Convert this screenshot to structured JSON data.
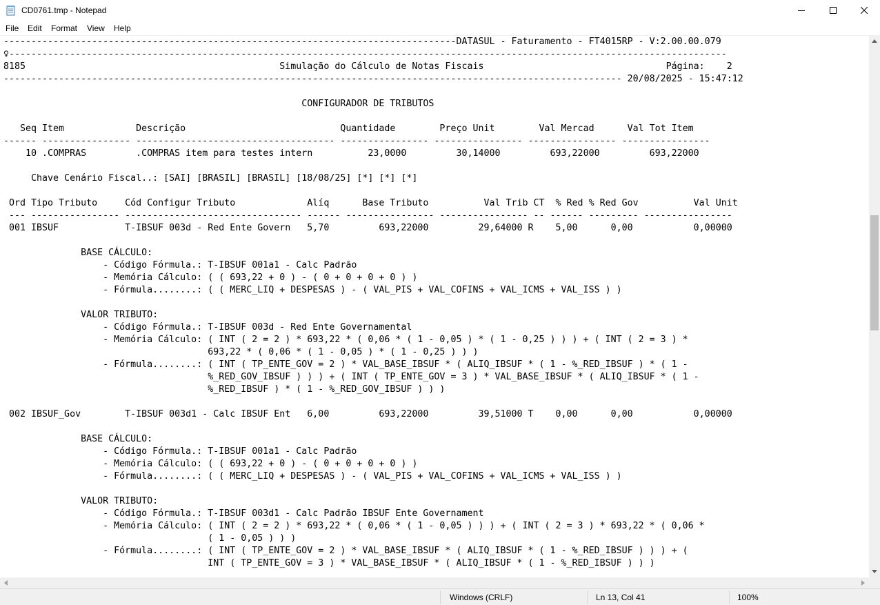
{
  "window": {
    "title": "CD0761.tmp - Notepad",
    "icon": "notepad-icon",
    "controls": [
      "minimize-icon",
      "maximize-icon",
      "close-icon"
    ]
  },
  "menu": {
    "file": "File",
    "edit": "Edit",
    "format": "Format",
    "view": "View",
    "help": "Help"
  },
  "document": {
    "lines": [
      "----------------------------------------------------------------------------------DATASUL - Faturamento - FT4015RP - V:2.00.00.079",
      "♀----------------------------------------------------------------------------------------------------------------------------------",
      "8185                                              Simulação do Cálculo de Notas Fiscais                                 Página:    2",
      "---------------------------------------------------------------------------------------------------------------- 20/08/2025 - 15:47:12",
      "",
      "                                                      CONFIGURADOR DE TRIBUTOS",
      "",
      "   Seq Item             Descrição                            Quantidade        Preço Unit        Val Mercad      Val Tot Item",
      "------ ---------------- ------------------------------------ ---------------- ---------------- ---------------- ----------------",
      "    10 .COMPRAS         .COMPRAS item para testes intern          23,0000         30,14000         693,22000         693,22000",
      "",
      "     Chave Cenário Fiscal..: [SAI] [BRASIL] [BRASIL] [18/08/25] [*] [*] [*]",
      "",
      " Ord Tipo Tributo     Cód Configur Tributo             Alíq      Base Tributo          Val Trib CT  % Red % Red Gov          Val Unit",
      " --- ---------------- -------------------------------- ------ ---------------- ---------------- -- ------ --------- ----------------",
      " 001 IBSUF            T-IBSUF 003d - Red Ente Govern   5,70         693,22000         29,64000 R    5,00      0,00           0,00000",
      "",
      "              BASE CÁLCULO:",
      "                  - Código Fórmula.: T-IBSUF 001a1 - Calc Padrão",
      "                  - Memória Cálculo: ( ( 693,22 + 0 ) - ( 0 + 0 + 0 + 0 ) )",
      "                  - Fórmula........: ( ( MERC_LIQ + DESPESAS ) - ( VAL_PIS + VAL_COFINS + VAL_ICMS + VAL_ISS ) )",
      "",
      "              VALOR TRIBUTO:",
      "                  - Código Fórmula.: T-IBSUF 003d - Red Ente Governamental",
      "                  - Memória Cálculo: ( INT ( 2 = 2 ) * 693,22 * ( 0,06 * ( 1 - 0,05 ) * ( 1 - 0,25 ) ) ) + ( INT ( 2 = 3 ) *",
      "                                     693,22 * ( 0,06 * ( 1 - 0,05 ) * ( 1 - 0,25 ) ) )",
      "                  - Fórmula........: ( INT ( TP_ENTE_GOV = 2 ) * VAL_BASE_IBSUF * ( ALIQ_IBSUF * ( 1 - %_RED_IBSUF ) * ( 1 -",
      "                                     %_RED_GOV_IBSUF ) ) ) + ( INT ( TP_ENTE_GOV = 3 ) * VAL_BASE_IBSUF * ( ALIQ_IBSUF * ( 1 -",
      "                                     %_RED_IBSUF ) * ( 1 - %_RED_GOV_IBSUF ) ) )",
      "",
      " 002 IBSUF_Gov        T-IBSUF 003d1 - Calc IBSUF Ent   6,00         693,22000         39,51000 T    0,00      0,00           0,00000",
      "",
      "              BASE CÁLCULO:",
      "                  - Código Fórmula.: T-IBSUF 001a1 - Calc Padrão",
      "                  - Memória Cálculo: ( ( 693,22 + 0 ) - ( 0 + 0 + 0 + 0 ) )",
      "                  - Fórmula........: ( ( MERC_LIQ + DESPESAS ) - ( VAL_PIS + VAL_COFINS + VAL_ICMS + VAL_ISS ) )",
      "",
      "              VALOR TRIBUTO:",
      "                  - Código Fórmula.: T-IBSUF 003d1 - Calc Padrão IBSUF Ente Governament",
      "                  - Memória Cálculo: ( INT ( 2 = 2 ) * 693,22 * ( 0,06 * ( 1 - 0,05 ) ) ) + ( INT ( 2 = 3 ) * 693,22 * ( 0,06 *",
      "                                     ( 1 - 0,05 ) ) )",
      "                  - Fórmula........: ( INT ( TP_ENTE_GOV = 2 ) * VAL_BASE_IBSUF * ( ALIQ_IBSUF * ( 1 - %_RED_IBSUF ) ) ) + (",
      "                                     INT ( TP_ENTE_GOV = 3 ) * VAL_BASE_IBSUF * ( ALIQ_IBSUF * ( 1 - %_RED_IBSUF ) ) )"
    ]
  },
  "statusbar": {
    "encoding": "Windows (CRLF)",
    "position": "Ln 13, Col 41",
    "zoom": "100%"
  }
}
